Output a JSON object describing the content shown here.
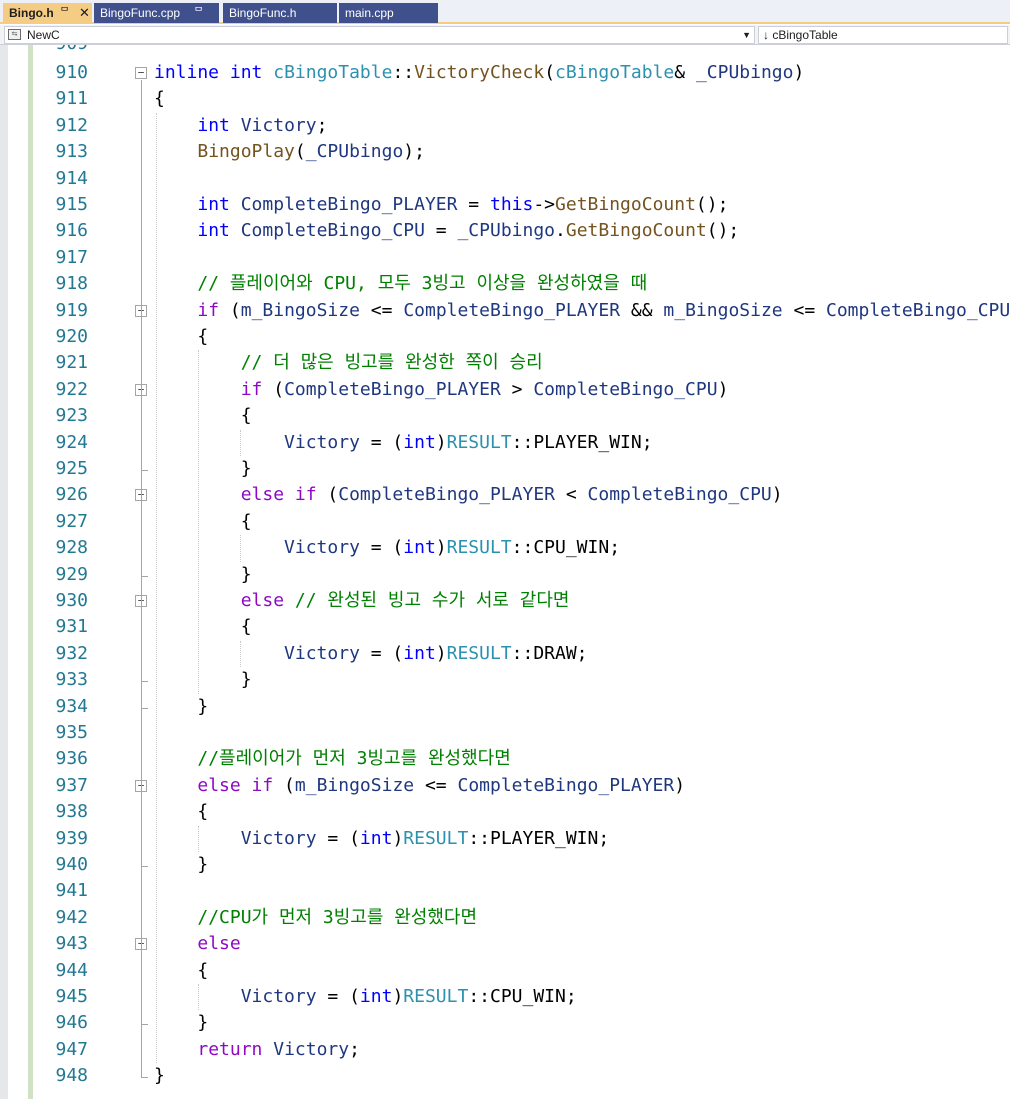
{
  "tabs": [
    {
      "label": "Bingo.h",
      "pin": "ᄆ",
      "close": "✕",
      "active": true
    },
    {
      "label": "BingoFunc.cpp",
      "pin": "ᄆ",
      "active": false
    },
    {
      "label": "BingoFunc.h",
      "active": false
    },
    {
      "label": "main.cpp",
      "active": false
    }
  ],
  "navbar": {
    "scope_label": "NewC",
    "scope_icon": "class-icon",
    "member_label": "↓ cBingoTable"
  },
  "colors": {
    "keyword": "#0000ff",
    "type": "#2b91af",
    "function": "#74531f",
    "identifier": "#1f377f",
    "comment": "#008000",
    "control": "#8f08c4",
    "line_number": "#237893",
    "active_tab": "#f5cc84",
    "inactive_tab": "#40508d"
  },
  "editor": {
    "partial_top_line": "909",
    "lines": [
      {
        "n": "910",
        "fold": "−",
        "tokens": [
          [
            "kw",
            "inline"
          ],
          [
            "pl",
            " "
          ],
          [
            "kw",
            "int"
          ],
          [
            "pl",
            " "
          ],
          [
            "ty",
            "cBingoTable"
          ],
          [
            "pl",
            "::"
          ],
          [
            "fn",
            "VictoryCheck"
          ],
          [
            "pl",
            "("
          ],
          [
            "ty",
            "cBingoTable"
          ],
          [
            "pl",
            "& "
          ],
          [
            "id",
            "_CPUbingo"
          ],
          [
            "pl",
            ")"
          ]
        ]
      },
      {
        "n": "911",
        "tokens": [
          [
            "pl",
            "{"
          ]
        ]
      },
      {
        "n": "912",
        "tokens": [
          [
            "pl",
            "    "
          ],
          [
            "kw",
            "int"
          ],
          [
            "pl",
            " "
          ],
          [
            "id",
            "Victory"
          ],
          [
            "pl",
            ";"
          ]
        ]
      },
      {
        "n": "913",
        "tokens": [
          [
            "pl",
            "    "
          ],
          [
            "fn",
            "BingoPlay"
          ],
          [
            "pl",
            "("
          ],
          [
            "id",
            "_CPUbingo"
          ],
          [
            "pl",
            ");"
          ]
        ]
      },
      {
        "n": "914",
        "tokens": []
      },
      {
        "n": "915",
        "tokens": [
          [
            "pl",
            "    "
          ],
          [
            "kw",
            "int"
          ],
          [
            "pl",
            " "
          ],
          [
            "id",
            "CompleteBingo_PLAYER"
          ],
          [
            "pl",
            " = "
          ],
          [
            "kw",
            "this"
          ],
          [
            "pl",
            "->"
          ],
          [
            "fn",
            "GetBingoCount"
          ],
          [
            "pl",
            "();"
          ]
        ]
      },
      {
        "n": "916",
        "tokens": [
          [
            "pl",
            "    "
          ],
          [
            "kw",
            "int"
          ],
          [
            "pl",
            " "
          ],
          [
            "id",
            "CompleteBingo_CPU"
          ],
          [
            "pl",
            " = "
          ],
          [
            "id",
            "_CPUbingo"
          ],
          [
            "pl",
            "."
          ],
          [
            "fn",
            "GetBingoCount"
          ],
          [
            "pl",
            "();"
          ]
        ]
      },
      {
        "n": "917",
        "tokens": []
      },
      {
        "n": "918",
        "tokens": [
          [
            "pl",
            "    "
          ],
          [
            "cm",
            "// 플레이어와 CPU, 모두 3빙고 이상을 완성하였을 때"
          ]
        ]
      },
      {
        "n": "919",
        "fold": "−",
        "tokens": [
          [
            "pl",
            "    "
          ],
          [
            "ctl",
            "if"
          ],
          [
            "pl",
            " ("
          ],
          [
            "id",
            "m_BingoSize"
          ],
          [
            "pl",
            " <= "
          ],
          [
            "id",
            "CompleteBingo_PLAYER"
          ],
          [
            "pl",
            " && "
          ],
          [
            "id",
            "m_BingoSize"
          ],
          [
            "pl",
            " <= "
          ],
          [
            "id",
            "CompleteBingo_CPU"
          ],
          [
            "pl",
            ")"
          ]
        ]
      },
      {
        "n": "920",
        "tokens": [
          [
            "pl",
            "    {"
          ]
        ]
      },
      {
        "n": "921",
        "tokens": [
          [
            "pl",
            "        "
          ],
          [
            "cm",
            "// 더 많은 빙고를 완성한 쪽이 승리"
          ]
        ]
      },
      {
        "n": "922",
        "fold": "−",
        "tokens": [
          [
            "pl",
            "        "
          ],
          [
            "ctl",
            "if"
          ],
          [
            "pl",
            " ("
          ],
          [
            "id",
            "CompleteBingo_PLAYER"
          ],
          [
            "pl",
            " > "
          ],
          [
            "id",
            "CompleteBingo_CPU"
          ],
          [
            "pl",
            ")"
          ]
        ]
      },
      {
        "n": "923",
        "tokens": [
          [
            "pl",
            "        {"
          ]
        ]
      },
      {
        "n": "924",
        "tokens": [
          [
            "pl",
            "            "
          ],
          [
            "id",
            "Victory"
          ],
          [
            "pl",
            " = ("
          ],
          [
            "kw",
            "int"
          ],
          [
            "pl",
            ")"
          ],
          [
            "ty",
            "RESULT"
          ],
          [
            "pl",
            "::PLAYER_WIN;"
          ]
        ]
      },
      {
        "n": "925",
        "tokens": [
          [
            "pl",
            "        }"
          ]
        ]
      },
      {
        "n": "926",
        "fold": "−",
        "tokens": [
          [
            "pl",
            "        "
          ],
          [
            "ctl",
            "else if"
          ],
          [
            "pl",
            " ("
          ],
          [
            "id",
            "CompleteBingo_PLAYER"
          ],
          [
            "pl",
            " < "
          ],
          [
            "id",
            "CompleteBingo_CPU"
          ],
          [
            "pl",
            ")"
          ]
        ]
      },
      {
        "n": "927",
        "tokens": [
          [
            "pl",
            "        {"
          ]
        ]
      },
      {
        "n": "928",
        "tokens": [
          [
            "pl",
            "            "
          ],
          [
            "id",
            "Victory"
          ],
          [
            "pl",
            " = ("
          ],
          [
            "kw",
            "int"
          ],
          [
            "pl",
            ")"
          ],
          [
            "ty",
            "RESULT"
          ],
          [
            "pl",
            "::CPU_WIN;"
          ]
        ]
      },
      {
        "n": "929",
        "tokens": [
          [
            "pl",
            "        }"
          ]
        ]
      },
      {
        "n": "930",
        "fold": "−",
        "tokens": [
          [
            "pl",
            "        "
          ],
          [
            "ctl",
            "else"
          ],
          [
            "pl",
            " "
          ],
          [
            "cm",
            "// 완성된 빙고 수가 서로 같다면"
          ]
        ]
      },
      {
        "n": "931",
        "tokens": [
          [
            "pl",
            "        {"
          ]
        ]
      },
      {
        "n": "932",
        "tokens": [
          [
            "pl",
            "            "
          ],
          [
            "id",
            "Victory"
          ],
          [
            "pl",
            " = ("
          ],
          [
            "kw",
            "int"
          ],
          [
            "pl",
            ")"
          ],
          [
            "ty",
            "RESULT"
          ],
          [
            "pl",
            "::DRAW;"
          ]
        ]
      },
      {
        "n": "933",
        "tokens": [
          [
            "pl",
            "        }"
          ]
        ]
      },
      {
        "n": "934",
        "tokens": [
          [
            "pl",
            "    }"
          ]
        ]
      },
      {
        "n": "935",
        "tokens": []
      },
      {
        "n": "936",
        "tokens": [
          [
            "pl",
            "    "
          ],
          [
            "cm",
            "//플레이어가 먼저 3빙고를 완성했다면"
          ]
        ]
      },
      {
        "n": "937",
        "fold": "−",
        "tokens": [
          [
            "pl",
            "    "
          ],
          [
            "ctl",
            "else if"
          ],
          [
            "pl",
            " ("
          ],
          [
            "id",
            "m_BingoSize"
          ],
          [
            "pl",
            " <= "
          ],
          [
            "id",
            "CompleteBingo_PLAYER"
          ],
          [
            "pl",
            ")"
          ]
        ]
      },
      {
        "n": "938",
        "tokens": [
          [
            "pl",
            "    {"
          ]
        ]
      },
      {
        "n": "939",
        "tokens": [
          [
            "pl",
            "        "
          ],
          [
            "id",
            "Victory"
          ],
          [
            "pl",
            " = ("
          ],
          [
            "kw",
            "int"
          ],
          [
            "pl",
            ")"
          ],
          [
            "ty",
            "RESULT"
          ],
          [
            "pl",
            "::PLAYER_WIN;"
          ]
        ]
      },
      {
        "n": "940",
        "tokens": [
          [
            "pl",
            "    }"
          ]
        ]
      },
      {
        "n": "941",
        "tokens": []
      },
      {
        "n": "942",
        "tokens": [
          [
            "pl",
            "    "
          ],
          [
            "cm",
            "//CPU가 먼저 3빙고를 완성했다면"
          ]
        ]
      },
      {
        "n": "943",
        "fold": "−",
        "tokens": [
          [
            "pl",
            "    "
          ],
          [
            "ctl",
            "else"
          ]
        ]
      },
      {
        "n": "944",
        "tokens": [
          [
            "pl",
            "    {"
          ]
        ]
      },
      {
        "n": "945",
        "tokens": [
          [
            "pl",
            "        "
          ],
          [
            "id",
            "Victory"
          ],
          [
            "pl",
            " = ("
          ],
          [
            "kw",
            "int"
          ],
          [
            "pl",
            ")"
          ],
          [
            "ty",
            "RESULT"
          ],
          [
            "pl",
            "::CPU_WIN;"
          ]
        ]
      },
      {
        "n": "946",
        "tokens": [
          [
            "pl",
            "    }"
          ]
        ]
      },
      {
        "n": "947",
        "tokens": [
          [
            "pl",
            "    "
          ],
          [
            "ctl",
            "return"
          ],
          [
            "pl",
            " "
          ],
          [
            "id",
            "Victory"
          ],
          [
            "pl",
            ";"
          ]
        ]
      },
      {
        "n": "948",
        "tokens": [
          [
            "pl",
            "}"
          ]
        ]
      }
    ]
  }
}
